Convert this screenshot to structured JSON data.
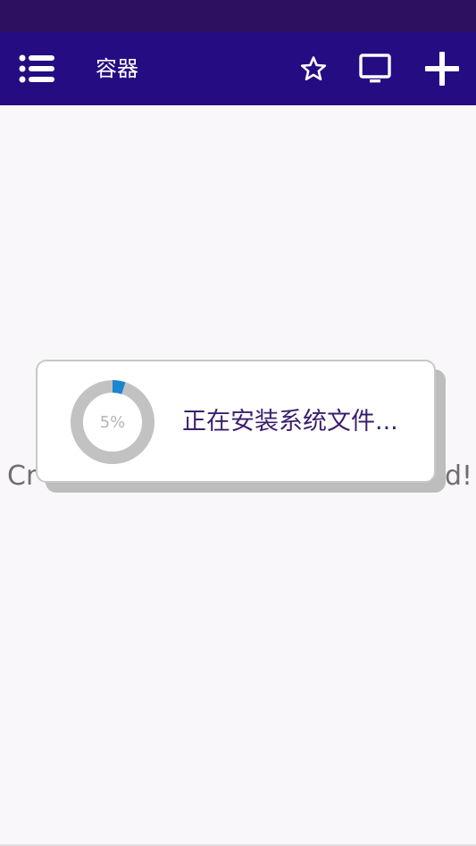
{
  "app_bar": {
    "title": "容器",
    "icons": {
      "menu": "list-menu-icon",
      "favorite": "star-outline-icon",
      "display": "monitor-icon",
      "add": "plus-icon"
    }
  },
  "background": {
    "message_start": "Cr",
    "message_end": "d!"
  },
  "dialog": {
    "progress_percent": 5,
    "progress_label": "5%",
    "message": "正在安装系统文件..."
  },
  "colors": {
    "status_bar": "#2d1060",
    "app_bar": "#260c82",
    "progress_track": "#c2c2c2",
    "progress_fill": "#1a86d0",
    "dialog_text": "#3a1f6e"
  }
}
